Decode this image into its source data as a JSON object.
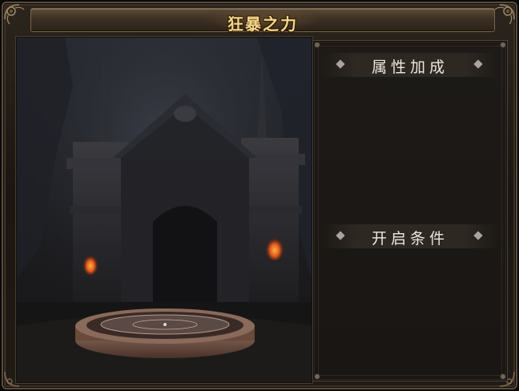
{
  "window": {
    "title": "狂暴之力"
  },
  "panel": {
    "sections": [
      {
        "title": "属性加成"
      },
      {
        "title": "开启条件"
      }
    ]
  },
  "colors": {
    "title_gold": "#f3d68a",
    "frame_bronze": "#5a4c3b",
    "panel_bg": "#1b1815",
    "section_text": "#ece7df",
    "ember": "#e0561c"
  },
  "icons": [
    "corner-ornament-icon",
    "diamond-bullet-icon"
  ]
}
